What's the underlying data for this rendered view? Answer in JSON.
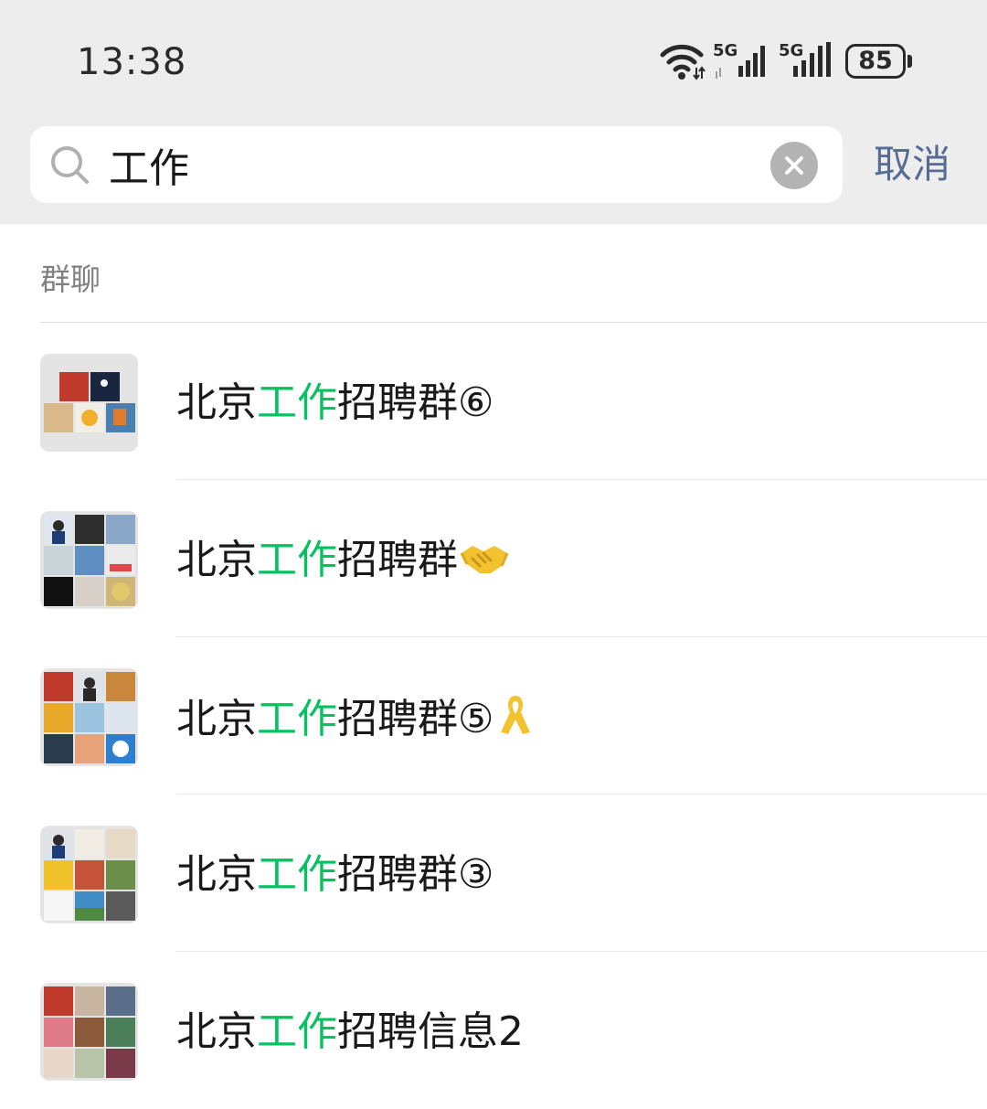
{
  "status_bar": {
    "time": "13:38",
    "network_1": "5G",
    "network_2": "5G",
    "battery": "85"
  },
  "search": {
    "query": "工作",
    "cancel_label": "取消"
  },
  "section": {
    "label": "群聊"
  },
  "results": [
    {
      "prefix": "北京",
      "match": "工作",
      "suffix": "招聘群⑥",
      "emoji_icon": ""
    },
    {
      "prefix": "北京",
      "match": "工作",
      "suffix": "招聘群",
      "emoji_icon": "handshake-emoji"
    },
    {
      "prefix": "北京",
      "match": "工作",
      "suffix": "招聘群⑤",
      "emoji_icon": "ribbon-emoji"
    },
    {
      "prefix": "北京",
      "match": "工作",
      "suffix": "招聘群③",
      "emoji_icon": ""
    },
    {
      "prefix": "北京",
      "match": "工作",
      "suffix": "招聘信息2",
      "emoji_icon": ""
    }
  ],
  "colors": {
    "highlight": "#07c160",
    "cancel": "#576b95",
    "background_top": "#ededed"
  }
}
